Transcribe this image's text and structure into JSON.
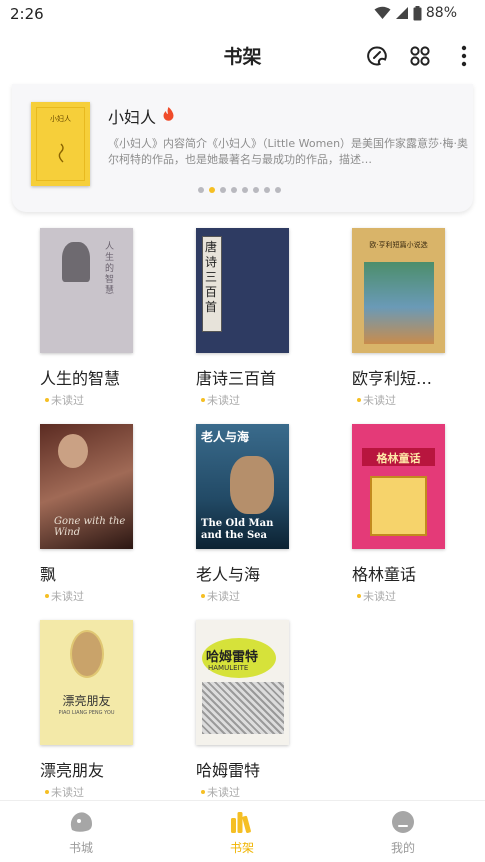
{
  "status_bar": {
    "time": "2:26",
    "battery": "88%"
  },
  "header": {
    "title": "书架"
  },
  "banner": {
    "cover_text": "小妇人",
    "title": "小妇人",
    "description": "《小妇人》内容简介《小妇人》（Little Women）是美国作家露意莎·梅·奥尔柯特的作品，也是她最著名与最成功的作品，描述…",
    "dot_count": 8,
    "active_dot": 1
  },
  "books": [
    {
      "title": "人生的智慧",
      "status": "未读过",
      "cover_text": "人生的智慧"
    },
    {
      "title": "唐诗三百首",
      "status": "未读过",
      "cover_text": "唐诗三百首"
    },
    {
      "title": "欧亨利短…",
      "status": "未读过",
      "cover_text": "欧·亨利短篇小说选"
    },
    {
      "title": "飘",
      "status": "未读过",
      "cover_text": "Gone with the Wind"
    },
    {
      "title": "老人与海",
      "status": "未读过",
      "cover_text": "老人与海",
      "cover_subtext": "The Old Man and the Sea"
    },
    {
      "title": "格林童话",
      "status": "未读过",
      "cover_text": "格林童话"
    },
    {
      "title": "漂亮朋友",
      "status": "未读过",
      "cover_text": "漂亮朋友",
      "cover_subtext": "PIAO LIANG PENG YOU"
    },
    {
      "title": "哈姆雷特",
      "status": "未读过",
      "cover_text": "哈姆雷特",
      "cover_subtext": "HAMULEITE"
    }
  ],
  "bottom_nav": [
    {
      "label": "书城",
      "icon": "bookstore-icon",
      "active": false
    },
    {
      "label": "书架",
      "icon": "bookshelf-icon",
      "active": true
    },
    {
      "label": "我的",
      "icon": "profile-icon",
      "active": false
    }
  ],
  "colors": {
    "accent": "#f5bf24",
    "active_nav": "#f0b400",
    "muted_text": "#aaaaaa"
  }
}
